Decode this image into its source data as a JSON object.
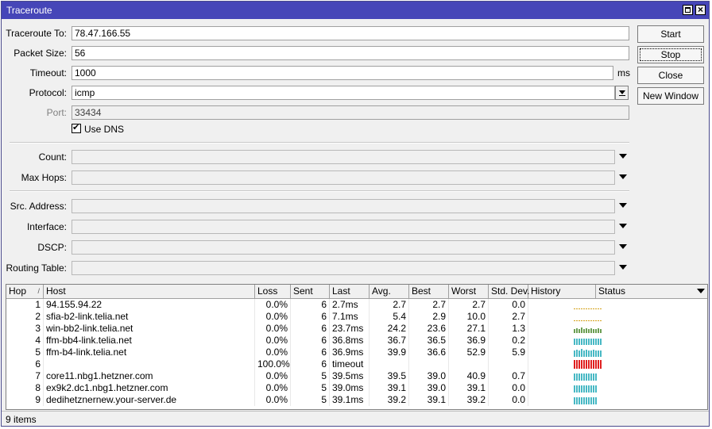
{
  "window": {
    "title": "Traceroute"
  },
  "form": {
    "traceroute_to": {
      "label": "Traceroute To:",
      "value": "78.47.166.55"
    },
    "packet_size": {
      "label": "Packet Size:",
      "value": "56"
    },
    "timeout": {
      "label": "Timeout:",
      "value": "1000",
      "unit": "ms"
    },
    "protocol": {
      "label": "Protocol:",
      "value": "icmp"
    },
    "port": {
      "label": "Port:",
      "value": "33434"
    },
    "use_dns": {
      "label": "Use DNS",
      "checked": true
    },
    "count": {
      "label": "Count:",
      "value": ""
    },
    "max_hops": {
      "label": "Max Hops:",
      "value": ""
    },
    "src_address": {
      "label": "Src. Address:",
      "value": ""
    },
    "interface": {
      "label": "Interface:",
      "value": ""
    },
    "dscp": {
      "label": "DSCP:",
      "value": ""
    },
    "routing_table": {
      "label": "Routing Table:",
      "value": ""
    }
  },
  "buttons": {
    "start": "Start",
    "stop": "Stop",
    "close": "Close",
    "new_window": "New Window"
  },
  "table": {
    "columns": {
      "hop": "Hop",
      "host": "Host",
      "loss": "Loss",
      "sent": "Sent",
      "last": "Last",
      "avg": "Avg.",
      "best": "Best",
      "worst": "Worst",
      "std_dev": "Std. Dev.",
      "history": "History",
      "status": "Status"
    },
    "sort_indicator": "/",
    "rows": [
      {
        "hop": "1",
        "host": "94.155.94.22",
        "loss": "0.0%",
        "sent": "6",
        "last": "2.7ms",
        "avg": "2.7",
        "best": "2.7",
        "worst": "2.7",
        "std_dev": "0.0",
        "history": [
          0.08,
          0.08,
          0.08,
          0.08,
          0.08,
          0.08,
          0.08,
          0.08,
          0.08,
          0.08,
          0.08,
          0.08
        ],
        "history_color": "#d4a017"
      },
      {
        "hop": "2",
        "host": "sfia-b2-link.telia.net",
        "loss": "0.0%",
        "sent": "6",
        "last": "7.1ms",
        "avg": "5.4",
        "best": "2.9",
        "worst": "10.0",
        "std_dev": "2.7",
        "history": [
          0.08,
          0.1,
          0.08,
          0.12,
          0.08,
          0.08,
          0.1,
          0.08,
          0.08,
          0.12,
          0.08,
          0.08
        ],
        "history_color": "#d4a017"
      },
      {
        "hop": "3",
        "host": "win-bb2-link.telia.net",
        "loss": "0.0%",
        "sent": "6",
        "last": "23.7ms",
        "avg": "24.2",
        "best": "23.6",
        "worst": "27.1",
        "std_dev": "1.3",
        "history": [
          0.45,
          0.5,
          0.45,
          0.6,
          0.45,
          0.5,
          0.45,
          0.5,
          0.45,
          0.45,
          0.5,
          0.45
        ],
        "history_color": "#6b9e52"
      },
      {
        "hop": "4",
        "host": "ffm-bb4-link.telia.net",
        "loss": "0.0%",
        "sent": "6",
        "last": "36.8ms",
        "avg": "36.7",
        "best": "36.5",
        "worst": "36.9",
        "std_dev": "0.2",
        "history": [
          0.75,
          0.75,
          0.75,
          0.75,
          0.75,
          0.75,
          0.75,
          0.75,
          0.75,
          0.75,
          0.75,
          0.75
        ],
        "history_color": "#47b8c4"
      },
      {
        "hop": "5",
        "host": "ffm-b4-link.telia.net",
        "loss": "0.0%",
        "sent": "6",
        "last": "36.9ms",
        "avg": "39.9",
        "best": "36.6",
        "worst": "52.9",
        "std_dev": "5.9",
        "history": [
          0.75,
          0.85,
          0.75,
          0.9,
          0.75,
          0.8,
          0.75,
          0.75,
          0.85,
          0.75,
          0.75,
          0.75
        ],
        "history_color": "#47b8c4"
      },
      {
        "hop": "6",
        "host": "",
        "loss": "100.0%",
        "sent": "6",
        "last": "timeout",
        "avg": "",
        "best": "",
        "worst": "",
        "std_dev": "",
        "history": [
          1,
          1,
          1,
          1,
          1,
          1,
          1,
          1,
          1,
          1,
          1,
          1
        ],
        "history_color": "#e02020"
      },
      {
        "hop": "7",
        "host": "core11.nbg1.hetzner.com",
        "loss": "0.0%",
        "sent": "5",
        "last": "39.5ms",
        "avg": "39.5",
        "best": "39.0",
        "worst": "40.9",
        "std_dev": "0.7",
        "history": [
          0.8,
          0.8,
          0.8,
          0.85,
          0.8,
          0.8,
          0.8,
          0.8,
          0.8,
          0.8
        ],
        "history_color": "#47b8c4"
      },
      {
        "hop": "8",
        "host": "ex9k2.dc1.nbg1.hetzner.com",
        "loss": "0.0%",
        "sent": "5",
        "last": "39.0ms",
        "avg": "39.1",
        "best": "39.0",
        "worst": "39.1",
        "std_dev": "0.0",
        "history": [
          0.8,
          0.8,
          0.8,
          0.8,
          0.8,
          0.8,
          0.8,
          0.8,
          0.8,
          0.8
        ],
        "history_color": "#47b8c4"
      },
      {
        "hop": "9",
        "host": "dedihetznernew.your-server.de",
        "loss": "0.0%",
        "sent": "5",
        "last": "39.1ms",
        "avg": "39.2",
        "best": "39.1",
        "worst": "39.2",
        "std_dev": "0.0",
        "history": [
          0.8,
          0.8,
          0.8,
          0.8,
          0.8,
          0.8,
          0.8,
          0.8,
          0.8,
          0.8
        ],
        "history_color": "#47b8c4"
      }
    ]
  },
  "statusbar": {
    "items_text": "9 items"
  }
}
